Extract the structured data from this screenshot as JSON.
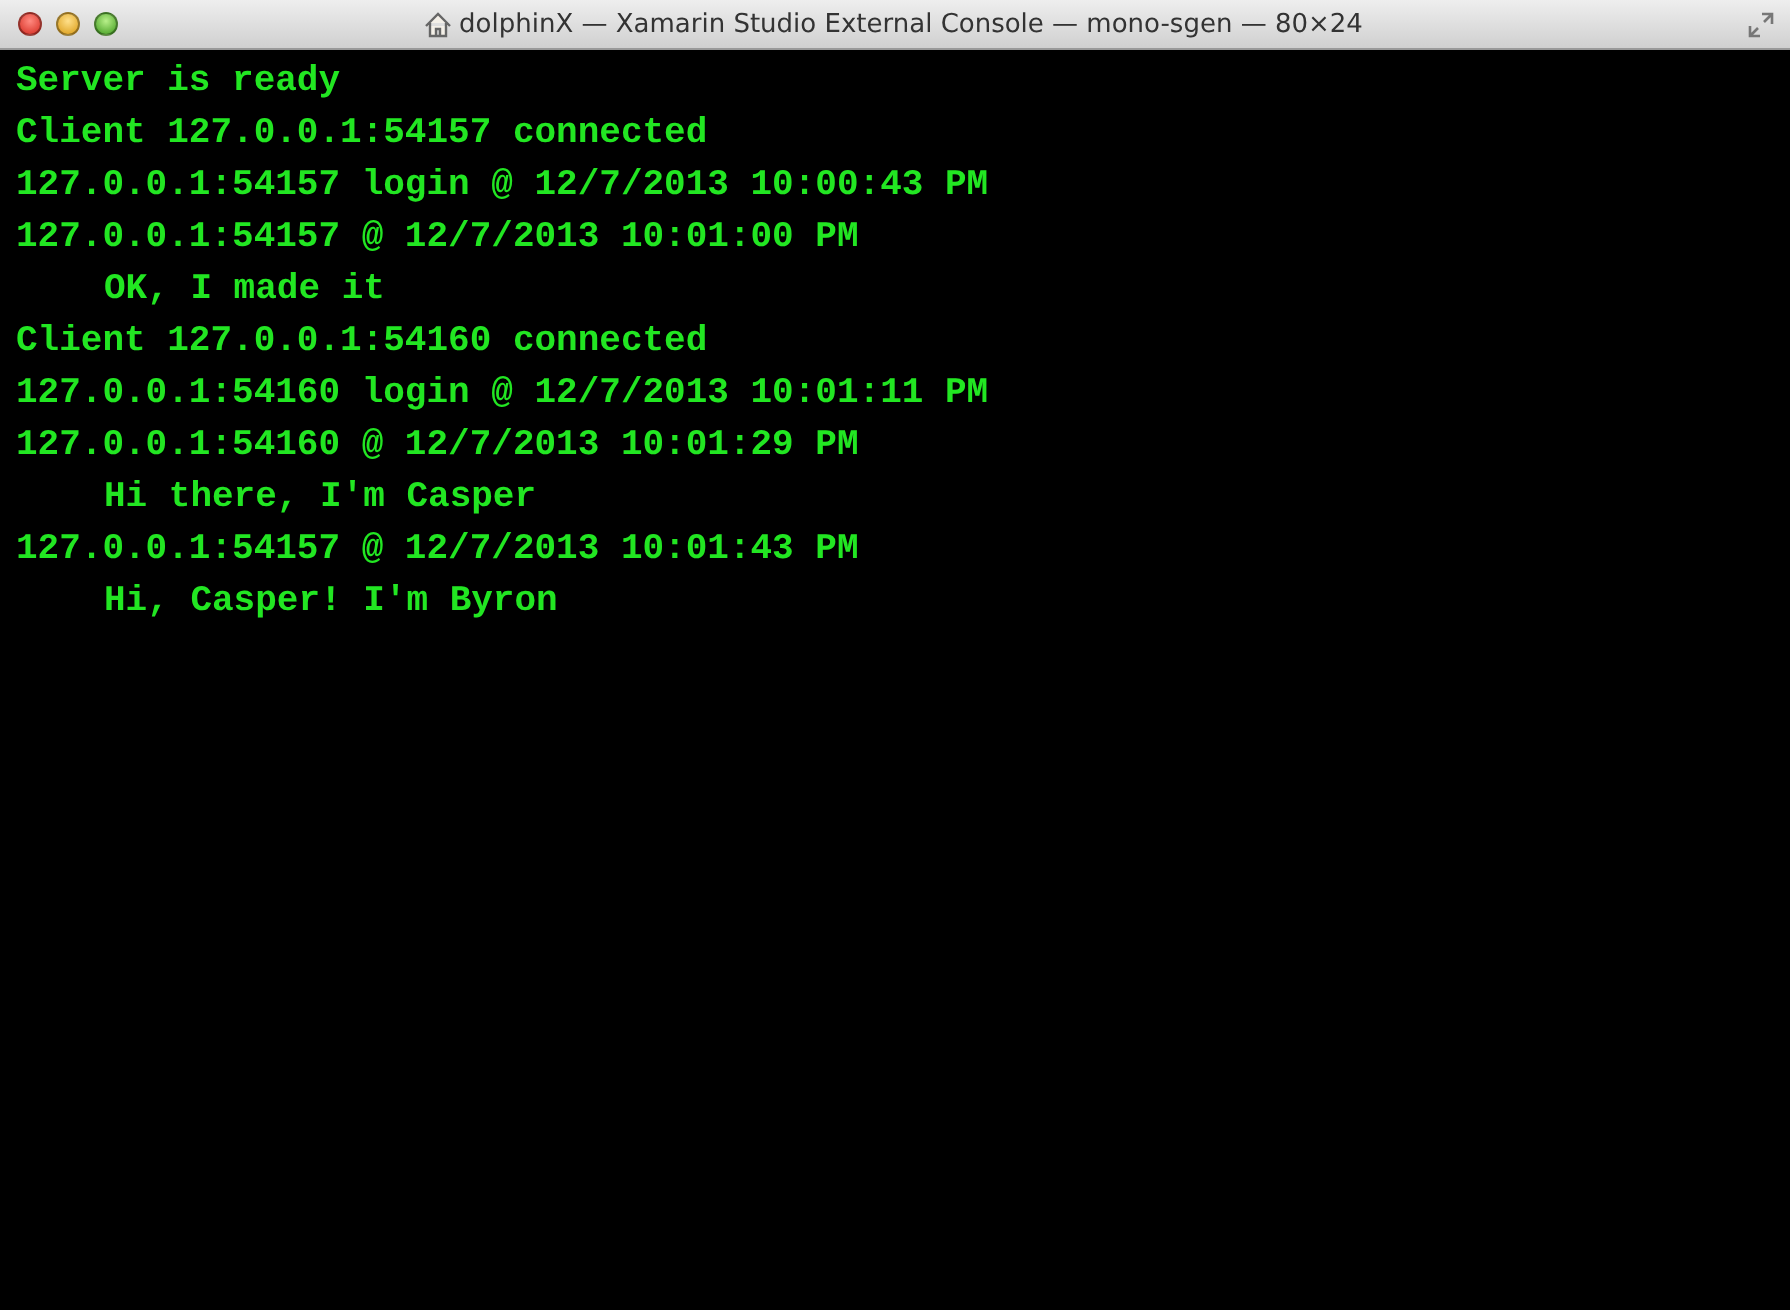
{
  "window": {
    "title": "dolphinX — Xamarin Studio External Console — mono-sgen — 80×24"
  },
  "console": {
    "lines": [
      {
        "kind": "event",
        "text": "Server is ready"
      },
      {
        "kind": "event",
        "text": "Client 127.0.0.1:54157 connected"
      },
      {
        "kind": "event",
        "text": "127.0.0.1:54157 login @ 12/7/2013 10:00:43 PM"
      },
      {
        "kind": "event",
        "text": "127.0.0.1:54157 @ 12/7/2013 10:01:00 PM"
      },
      {
        "kind": "message",
        "text": "OK, I made it"
      },
      {
        "kind": "event",
        "text": "Client 127.0.0.1:54160 connected"
      },
      {
        "kind": "event",
        "text": "127.0.0.1:54160 login @ 12/7/2013 10:01:11 PM"
      },
      {
        "kind": "event",
        "text": "127.0.0.1:54160 @ 12/7/2013 10:01:29 PM"
      },
      {
        "kind": "message",
        "text": "Hi there, I'm Casper"
      },
      {
        "kind": "event",
        "text": "127.0.0.1:54157 @ 12/7/2013 10:01:43 PM"
      },
      {
        "kind": "message",
        "text": "Hi, Casper! I'm Byron"
      }
    ]
  }
}
